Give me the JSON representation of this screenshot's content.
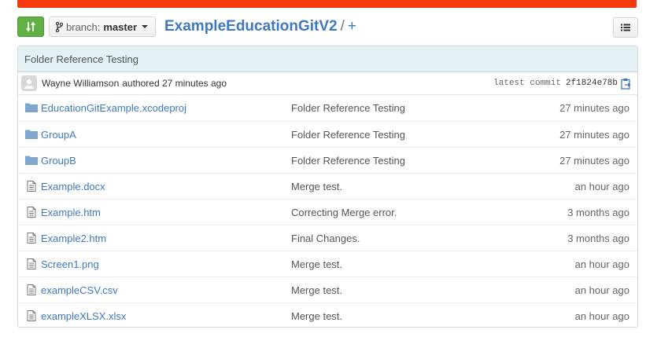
{
  "colors": {
    "accent": "#4078c0",
    "top_bar": "#f63a0f",
    "compare_button": "#60b044",
    "commit_bar": "#e6f1f6"
  },
  "toolbar": {
    "compare_icon": "compare-arrows-icon",
    "branch_label": "branch:",
    "branch_name": "master",
    "repo_name": "ExampleEducationGitV2",
    "path_separator": "/",
    "new_file_label": "+",
    "list_icon": "list-icon"
  },
  "commit": {
    "message": "Folder Reference Testing",
    "author": "Wayne Williamson",
    "authored_text": "authored 27 minutes ago",
    "latest_label": "latest commit",
    "sha": "2f1824e78b",
    "copy_icon": "clipboard-icon"
  },
  "files": [
    {
      "type": "folder",
      "name": "EducationGitExample.xcodeproj",
      "message": "Folder Reference Testing",
      "age": "27 minutes ago"
    },
    {
      "type": "folder",
      "name": "GroupA",
      "message": "Folder Reference Testing",
      "age": "27 minutes ago"
    },
    {
      "type": "folder",
      "name": "GroupB",
      "message": "Folder Reference Testing",
      "age": "27 minutes ago"
    },
    {
      "type": "file",
      "name": "Example.docx",
      "message": "Merge test.",
      "age": "an hour ago"
    },
    {
      "type": "file",
      "name": "Example.htm",
      "message": "Correcting Merge error.",
      "age": "3 months ago"
    },
    {
      "type": "file",
      "name": "Example2.htm",
      "message": "Final Changes.",
      "age": "3 months ago"
    },
    {
      "type": "file",
      "name": "Screen1.png",
      "message": "Merge test.",
      "age": "an hour ago"
    },
    {
      "type": "file",
      "name": "exampleCSV.csv",
      "message": "Merge test.",
      "age": "an hour ago"
    },
    {
      "type": "file",
      "name": "exampleXLSX.xlsx",
      "message": "Merge test.",
      "age": "an hour ago"
    }
  ]
}
